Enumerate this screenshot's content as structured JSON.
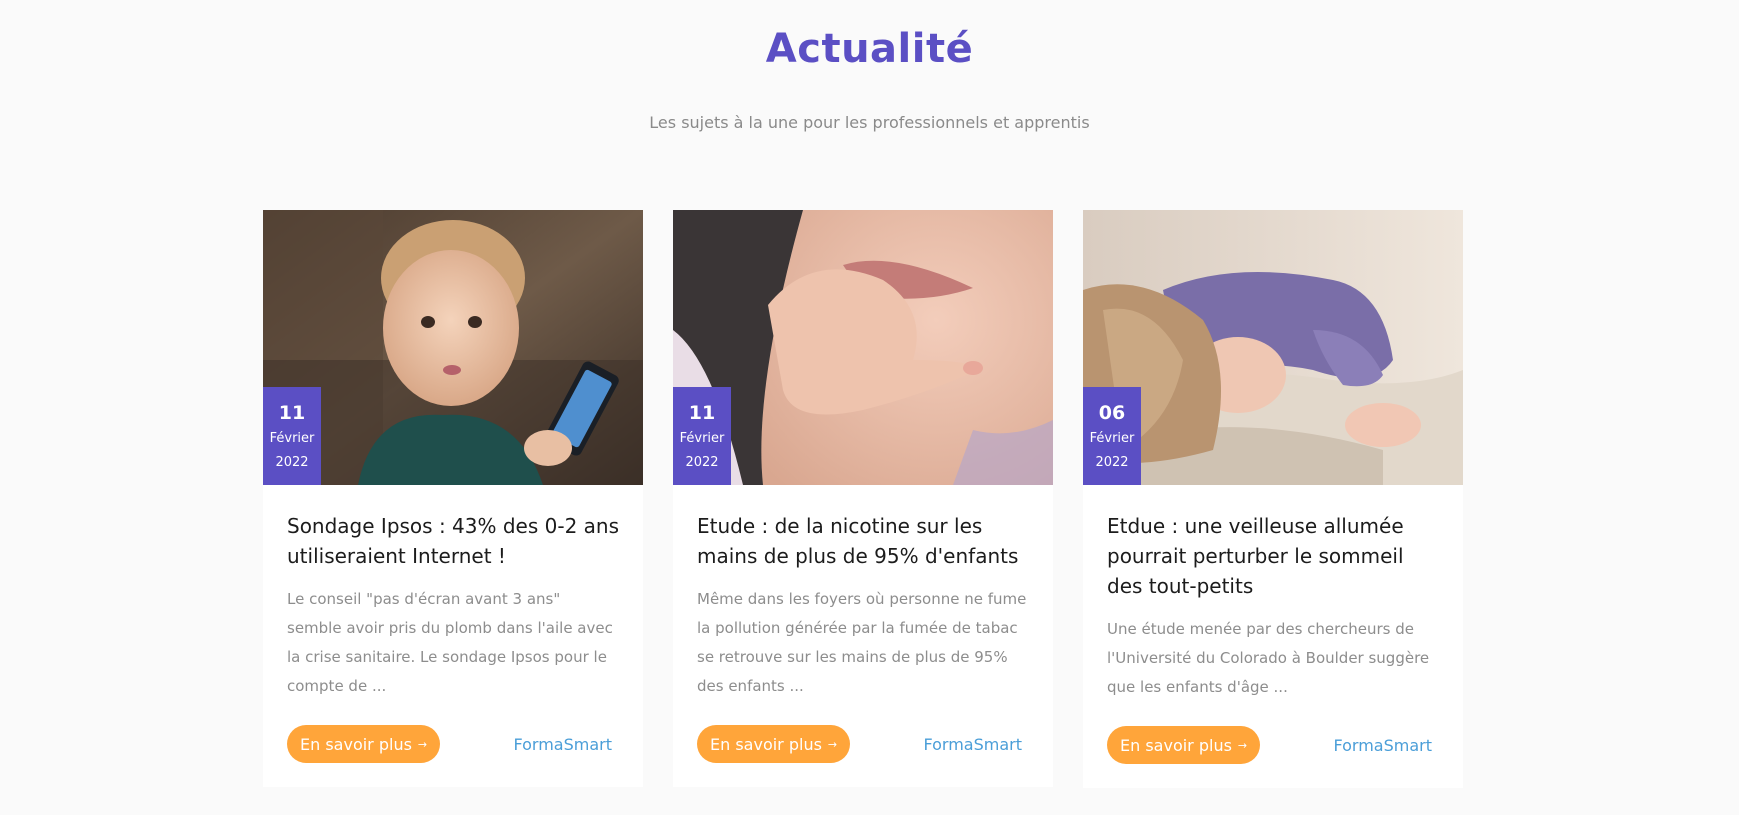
{
  "section": {
    "title": "Actualité",
    "subtitle": "Les sujets à la une pour les professionnels et apprentis"
  },
  "colors": {
    "title": "#5b4fc4",
    "date_badge": "#5b4fc4",
    "button": "#ffa53a",
    "author_link": "#4a9ed8"
  },
  "cards": [
    {
      "image_alt": "baby-with-smartphone-photo",
      "date": {
        "day": "11",
        "month": "Février",
        "year": "2022"
      },
      "title": "Sondage Ipsos : 43% des 0-2 ans utiliseraient Internet !",
      "excerpt": "Le conseil \"pas d'écran avant 3 ans\" semble avoir pris du plomb dans l'aile avec la crise sanitaire. Le sondage Ipsos pour le compte de ...",
      "button_label": "En savoir plus",
      "author": "FormaSmart"
    },
    {
      "image_alt": "baby-hand-in-mouth-photo",
      "date": {
        "day": "11",
        "month": "Février",
        "year": "2022"
      },
      "title": "Etude : de la nicotine sur les mains de plus de 95% d'enfants",
      "excerpt": "Même dans les foyers où personne ne fume la pollution générée par la fumée de tabac se retrouve sur les mains de plus de 95% des enfants ...",
      "button_label": "En savoir plus",
      "author": "FormaSmart"
    },
    {
      "image_alt": "sleeping-child-photo",
      "date": {
        "day": "06",
        "month": "Février",
        "year": "2022"
      },
      "title": "Etdue : une veilleuse allumée pourrait perturber le sommeil des tout-petits",
      "excerpt": "Une étude menée par des chercheurs de l'Université du Colorado à Boulder suggère que les enfants d'âge ...",
      "button_label": "En savoir plus",
      "author": "FormaSmart"
    }
  ]
}
